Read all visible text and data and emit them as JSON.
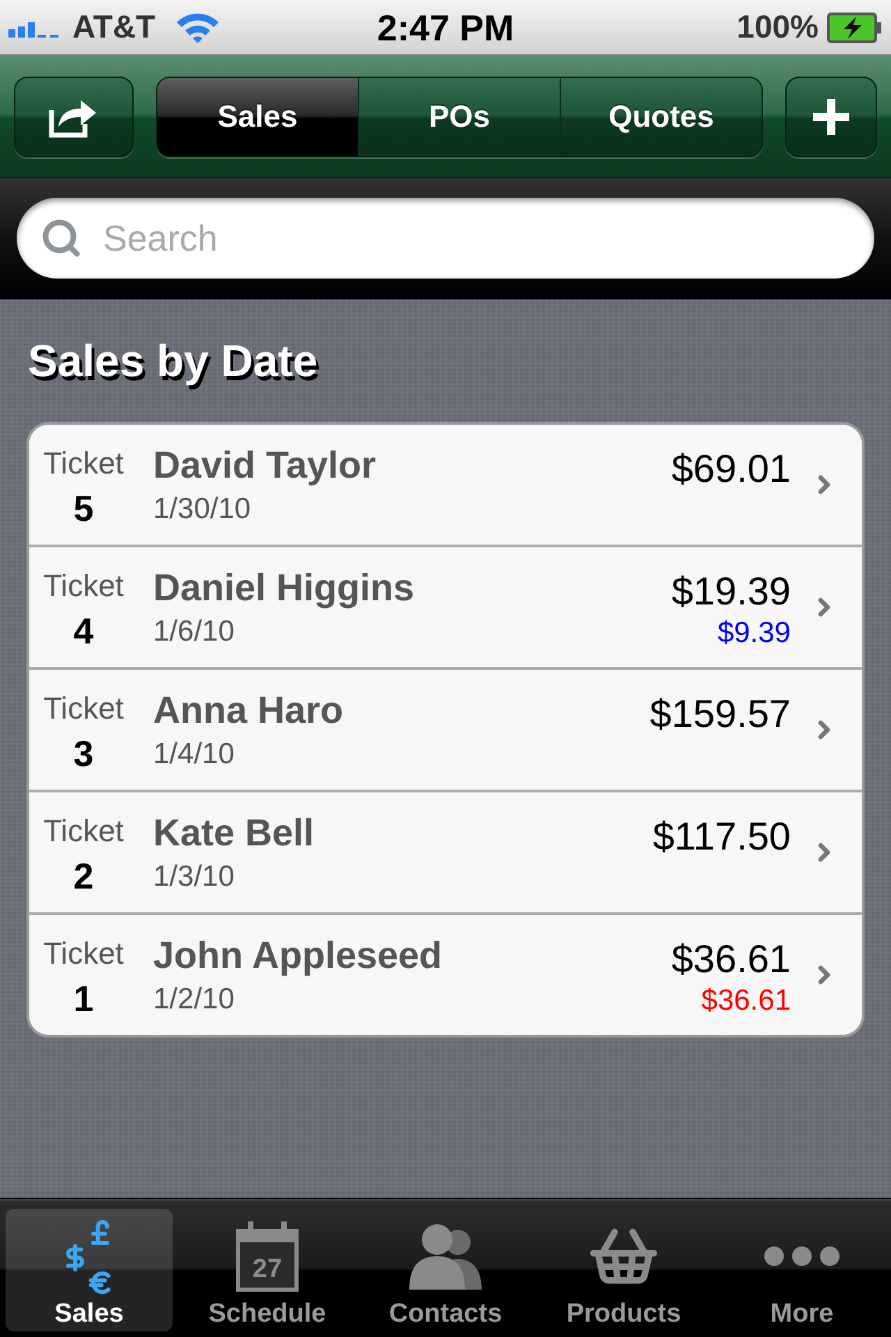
{
  "status_bar": {
    "carrier": "AT&T",
    "time": "2:47 PM",
    "battery": "100%"
  },
  "nav_bar": {
    "segments": [
      {
        "label": "Sales",
        "selected": true
      },
      {
        "label": "POs",
        "selected": false
      },
      {
        "label": "Quotes",
        "selected": false
      }
    ]
  },
  "search": {
    "placeholder": "Search"
  },
  "section": {
    "title": "Sales by Date",
    "rows": [
      {
        "ticket_label": "Ticket",
        "ticket_number": "5",
        "name": "David Taylor",
        "date": "1/30/10",
        "amount": "$69.01"
      },
      {
        "ticket_label": "Ticket",
        "ticket_number": "4",
        "name": "Daniel Higgins",
        "date": "1/6/10",
        "amount": "$19.39",
        "secondary_amount": {
          "text": "$9.39",
          "color": "#0000ff"
        }
      },
      {
        "ticket_label": "Ticket",
        "ticket_number": "3",
        "name": "Anna Haro",
        "date": "1/4/10",
        "amount": "$159.57"
      },
      {
        "ticket_label": "Ticket",
        "ticket_number": "2",
        "name": "Kate Bell",
        "date": "1/3/10",
        "amount": "$117.50"
      },
      {
        "ticket_label": "Ticket",
        "ticket_number": "1",
        "name": "John Appleseed",
        "date": "1/2/10",
        "amount": "$36.61",
        "secondary_amount": {
          "text": "$36.61",
          "color": "#ff0000"
        }
      }
    ]
  },
  "tab_bar": {
    "items": [
      {
        "label": "Sales",
        "kind": "currency",
        "selected": true
      },
      {
        "label": "Schedule",
        "kind": "calendar",
        "icon_text": "27",
        "selected": false
      },
      {
        "label": "Contacts",
        "kind": "people",
        "selected": false
      },
      {
        "label": "Products",
        "kind": "basket",
        "selected": false
      },
      {
        "label": "More",
        "kind": "more",
        "selected": false
      }
    ]
  }
}
